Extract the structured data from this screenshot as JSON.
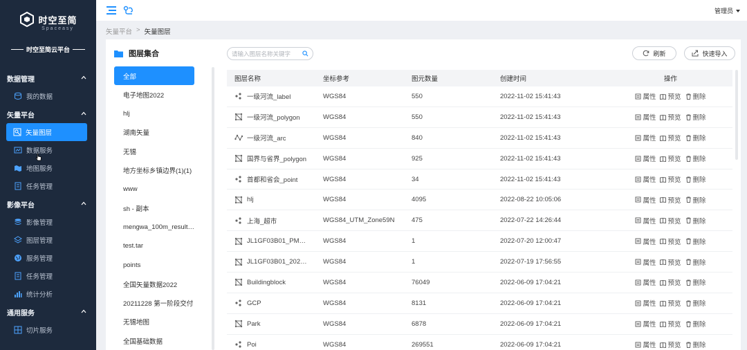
{
  "brand": {
    "title": "时空至简",
    "subtitle": "Spaceasy",
    "platform": "时空至简云平台"
  },
  "sidebar": {
    "groups": [
      {
        "label": "数据管理",
        "items": [
          {
            "label": "我的数据",
            "icon": "database-icon"
          }
        ]
      },
      {
        "label": "矢量平台",
        "items": [
          {
            "label": "矢量图层",
            "icon": "vector-layer-icon",
            "active": true
          },
          {
            "label": "数据服务",
            "icon": "data-service-icon"
          },
          {
            "label": "地图服务",
            "icon": "map-service-icon"
          },
          {
            "label": "任务管理",
            "icon": "task-icon"
          }
        ]
      },
      {
        "label": "影像平台",
        "items": [
          {
            "label": "影像管理",
            "icon": "image-manage-icon"
          },
          {
            "label": "图层管理",
            "icon": "layers-icon"
          },
          {
            "label": "服务管理",
            "icon": "globe-icon"
          },
          {
            "label": "任务管理",
            "icon": "task-icon"
          },
          {
            "label": "统计分析",
            "icon": "chart-icon"
          }
        ]
      },
      {
        "label": "通用服务",
        "items": [
          {
            "label": "切片服务",
            "icon": "tile-icon"
          }
        ]
      }
    ]
  },
  "topbar": {
    "user": "管理员"
  },
  "breadcrumb": {
    "parent": "矢量平台",
    "current": "矢量图层"
  },
  "layers": {
    "title": "图层集合",
    "items": [
      "全部",
      "电子地图2022",
      "hlj",
      "湖南矢量",
      "无锡",
      "地方坐标乡镇边界(1)(1)",
      "www",
      "sh - 副本",
      "mengwa_100m_result…",
      "test.tar",
      "points",
      "全国矢量数据2022",
      "20211228 第一阶段交付",
      "无锡地图",
      "全国基础数据"
    ]
  },
  "toolbar": {
    "search_placeholder": "请输入图层名称关键字",
    "refresh": "刷新",
    "import": "快速导入"
  },
  "table": {
    "headers": {
      "name": "图层名称",
      "crs": "坐标参考",
      "count": "图元数量",
      "created": "创建时间",
      "ops": "操作"
    },
    "ops": {
      "attr": "属性",
      "preview": "预览",
      "delete": "删除"
    },
    "rows": [
      {
        "name": "一级河流_label",
        "type": "point",
        "crs": "WGS84",
        "count": "550",
        "created": "2022-11-02 15:41:43"
      },
      {
        "name": "一级河流_polygon",
        "type": "polygon",
        "crs": "WGS84",
        "count": "550",
        "created": "2022-11-02 15:41:43"
      },
      {
        "name": "一级河流_arc",
        "type": "line",
        "crs": "WGS84",
        "count": "840",
        "created": "2022-11-02 15:41:43"
      },
      {
        "name": "国界与省界_polygon",
        "type": "polygon",
        "crs": "WGS84",
        "count": "925",
        "created": "2022-11-02 15:41:43"
      },
      {
        "name": "首都和省会_point",
        "type": "point",
        "crs": "WGS84",
        "count": "34",
        "created": "2022-11-02 15:41:43"
      },
      {
        "name": "hlj",
        "type": "polygon",
        "crs": "WGS84",
        "count": "4095",
        "created": "2022-08-22 10:05:06"
      },
      {
        "name": "上海_超市",
        "type": "point",
        "crs": "WGS84_UTM_Zone59N",
        "count": "475",
        "created": "2022-07-22 14:26:44"
      },
      {
        "name": "JL1GF03B01_PM…",
        "type": "polygon",
        "crs": "WGS84",
        "count": "1",
        "created": "2022-07-20 12:00:47"
      },
      {
        "name": "JL1GF03B01_202…",
        "type": "polygon",
        "crs": "WGS84",
        "count": "1",
        "created": "2022-07-19 17:56:55"
      },
      {
        "name": "Buildingblock",
        "type": "polygon",
        "crs": "WGS84",
        "count": "76049",
        "created": "2022-06-09 17:04:21"
      },
      {
        "name": "GCP",
        "type": "point",
        "crs": "WGS84",
        "count": "8131",
        "created": "2022-06-09 17:04:21"
      },
      {
        "name": "Park",
        "type": "polygon",
        "crs": "WGS84",
        "count": "6878",
        "created": "2022-06-09 17:04:21"
      },
      {
        "name": "Poi",
        "type": "point",
        "crs": "WGS84",
        "count": "269551",
        "created": "2022-06-09 17:04:21"
      }
    ]
  },
  "colors": {
    "sidebar_bg": "#1d2a3d",
    "accent": "#1e90ff"
  }
}
